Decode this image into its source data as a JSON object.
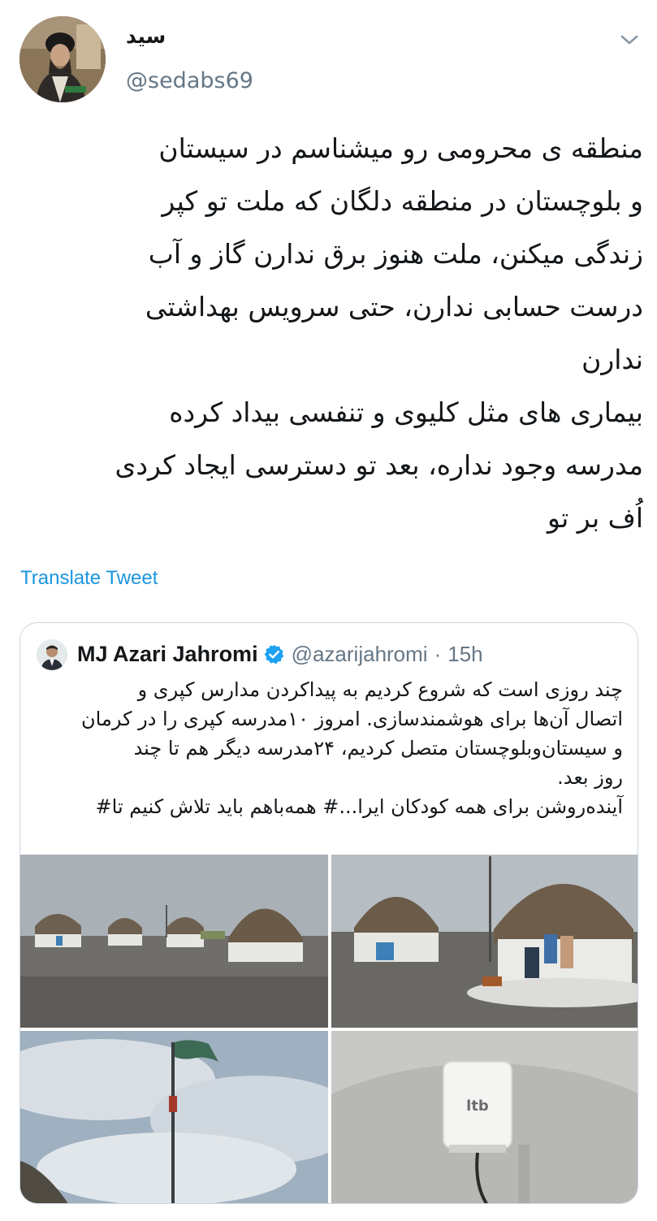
{
  "tweet": {
    "author_name": "سید",
    "author_handle": "@sedabs69",
    "text_lines": [
      "منطقه ی محرومی رو میشناسم در سیستان",
      "و بلوچستان در منطقه دلگان که ملت تو کپر",
      "زندگی میکنن، ملت هنوز برق ندارن گاز و آب",
      "درست حسابی ندارن، حتی سرویس بهداشتی",
      "ندارن",
      "بیماری های مثل کلیوی و تنفسی بیداد کرده",
      "مدرسه وجود نداره، بعد تو دسترسی ایجاد کردی",
      "اُف بر تو"
    ],
    "translate_label": "Translate Tweet",
    "menu_icon": "chevron-down-icon"
  },
  "quoted": {
    "name": "MJ Azari Jahromi",
    "handle": "@azarijahromi",
    "separator": "·",
    "time": "15h",
    "verified_icon": "verified-badge-icon",
    "text_lines": [
      "چند روزی است که شروع کردیم به پیداکردن مدارس کپری و",
      "اتصال آن‌ها برای هوشمندسازی. امروز ۱۰مدرسه کپری را در کرمان",
      "و سیستان‌وبلوچستان متصل کردیم، ۲۴مدرسه دیگر هم تا چند",
      "روز بعد.",
      "آینده‌روشن برای همه کودکان ایرا...# همه‌باهم باید تلاش کنیم تا#"
    ],
    "accent_color": "#1da1f2"
  },
  "colors": {
    "link": "#1b95e0",
    "secondary_text": "#657786",
    "border": "#ccd6dd"
  }
}
